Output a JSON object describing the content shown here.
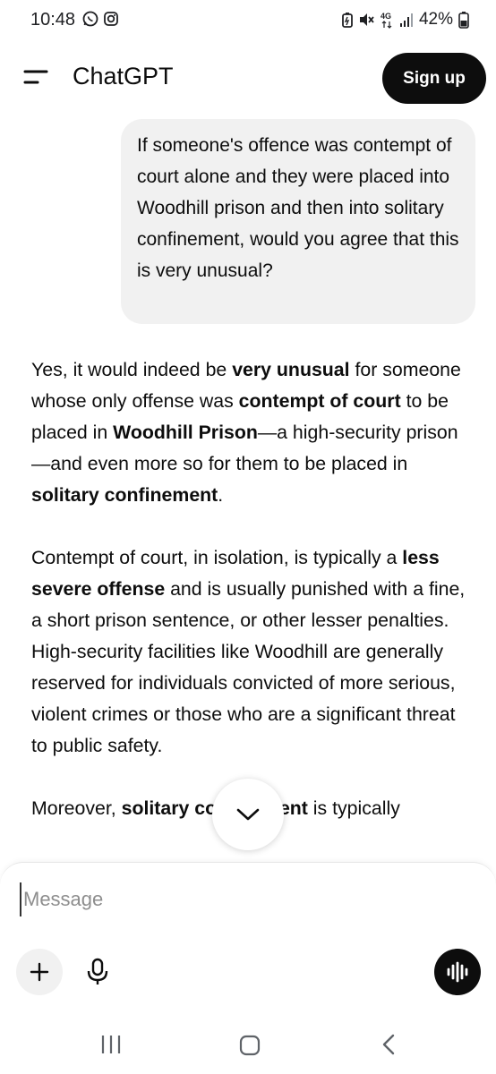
{
  "status_bar": {
    "time": "10:48",
    "battery": "42%",
    "left_icons": [
      "whatsapp-icon",
      "instagram-icon"
    ],
    "right_icons": [
      "battery-saver-icon",
      "mute-icon",
      "4g-icon",
      "signal-icon",
      "battery-icon"
    ]
  },
  "header": {
    "title": "ChatGPT",
    "signup_label": "Sign up"
  },
  "user_message": "If someone's offence was contempt of court alone and they were placed into Woodhill prison and then into solitary confinement, would you agree that this is very unusual?",
  "assistant": {
    "paragraphs": [
      [
        {
          "t": "Yes, it would indeed be "
        },
        {
          "t": "very unusual",
          "b": true
        },
        {
          "t": " for someone whose only offense was "
        },
        {
          "t": "contempt of court",
          "b": true
        },
        {
          "t": " to be placed in "
        },
        {
          "t": "Woodhill Prison",
          "b": true
        },
        {
          "t": "—a high-security prison—and even more so for them to be placed in "
        },
        {
          "t": "solitary confinement",
          "b": true
        },
        {
          "t": "."
        }
      ],
      [
        {
          "t": "Contempt of court, in isolation, is typically a "
        },
        {
          "t": "less severe offense",
          "b": true
        },
        {
          "t": " and is usually punished with a fine, a short prison sentence, or other lesser penalties. High-security facilities like Woodhill are generally reserved for individuals convicted of more serious, violent crimes or those who are a significant threat to public safety."
        }
      ],
      [
        {
          "t": "Moreover, "
        },
        {
          "t": "solitary confinement",
          "b": true
        },
        {
          "t": " is typically"
        }
      ]
    ]
  },
  "composer": {
    "placeholder": "Message"
  },
  "colors": {
    "primary": "#0d0d0d",
    "bubble": "#f1f1f1",
    "background": "#ffffff"
  }
}
